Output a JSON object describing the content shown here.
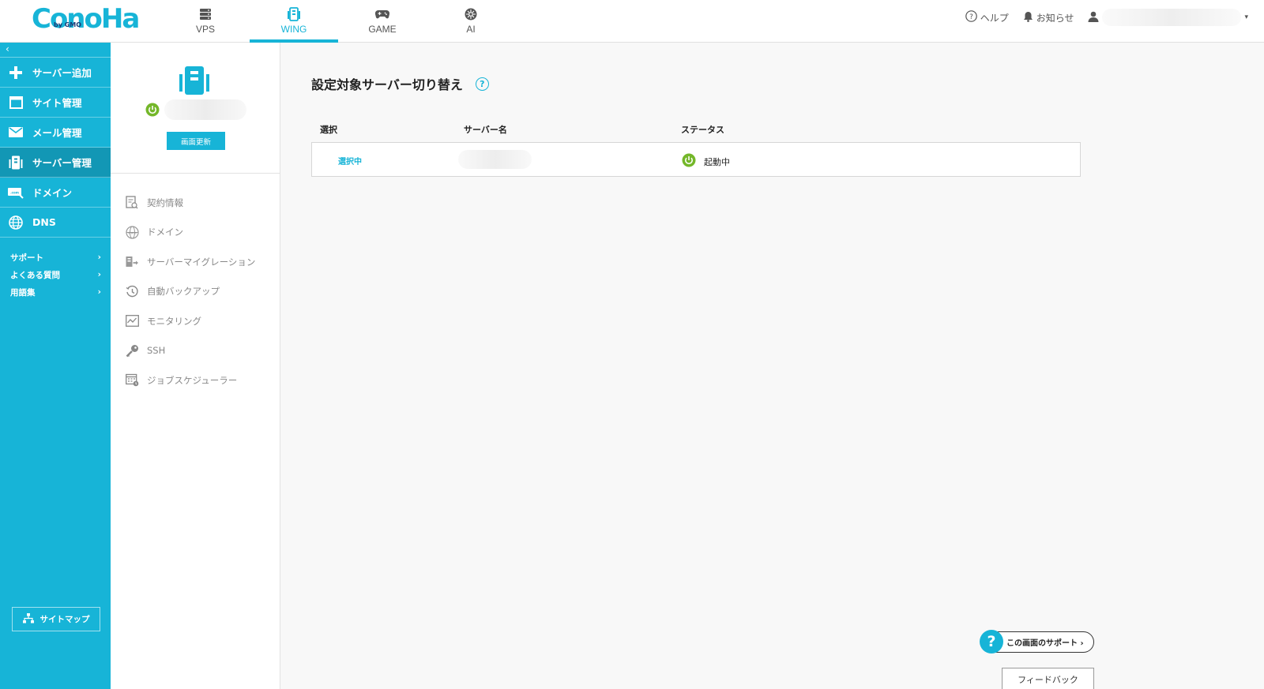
{
  "brand": {
    "logo_text": "ConoHa",
    "logo_sub": "by GMO"
  },
  "topnav": [
    {
      "label": "VPS",
      "icon": "server-stack-icon"
    },
    {
      "label": "WING",
      "icon": "wing-server-icon",
      "active": true
    },
    {
      "label": "GAME",
      "icon": "gamepad-icon"
    },
    {
      "label": "AI",
      "icon": "ai-chip-icon"
    }
  ],
  "header_right": {
    "help": "ヘルプ",
    "notice": "お知らせ"
  },
  "sidebar": {
    "collapse": "‹",
    "items": [
      {
        "label": "サーバー追加",
        "icon": "plus-icon"
      },
      {
        "label": "サイト管理",
        "icon": "window-icon"
      },
      {
        "label": "メール管理",
        "icon": "mail-icon"
      },
      {
        "label": "サーバー管理",
        "icon": "server-icon",
        "active": true
      },
      {
        "label": "ドメイン",
        "icon": "domain-icon"
      },
      {
        "label": "DNS",
        "icon": "globe-icon"
      }
    ],
    "links": [
      {
        "label": "サポート"
      },
      {
        "label": "よくある質問"
      },
      {
        "label": "用語集"
      }
    ],
    "sitemap": "サイトマップ"
  },
  "server_card": {
    "refresh": "画面更新"
  },
  "submenu": [
    {
      "label": "契約情報",
      "icon": "contract-icon"
    },
    {
      "label": "ドメイン",
      "icon": "www-icon"
    },
    {
      "label": "サーバーマイグレーション",
      "icon": "migration-icon"
    },
    {
      "label": "自動バックアップ",
      "icon": "backup-clock-icon"
    },
    {
      "label": "モニタリング",
      "icon": "monitoring-icon"
    },
    {
      "label": "SSH",
      "icon": "key-icon"
    },
    {
      "label": "ジョブスケジューラー",
      "icon": "scheduler-icon"
    }
  ],
  "main": {
    "title": "設定対象サーバー切り替え",
    "help": "?",
    "table": {
      "headers": {
        "select": "選択",
        "server_name": "サーバー名",
        "status": "ステータス"
      },
      "rows": [
        {
          "select": "選択中",
          "status": "起動中"
        }
      ]
    }
  },
  "support_button": {
    "icon_text": "?",
    "label": "この画面のサポート ›"
  },
  "feedback_button": "フィードバック",
  "colors": {
    "accent": "#17b4d7",
    "active_dark": "#1297b5",
    "power_green": "#74b72a"
  }
}
